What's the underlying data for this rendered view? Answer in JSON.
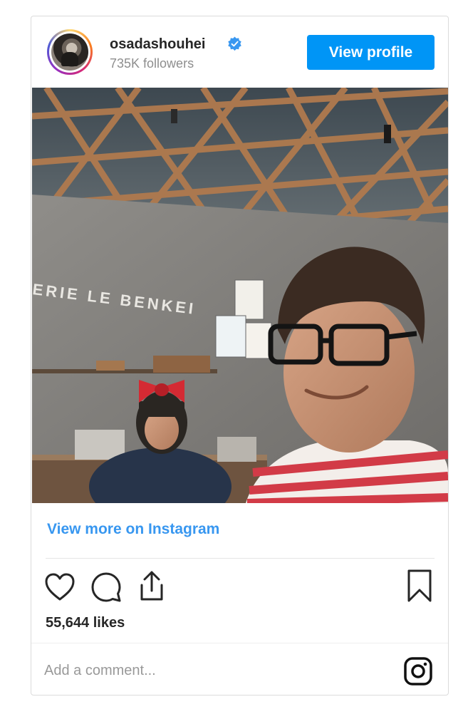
{
  "post": {
    "username": "osadashouhei",
    "followers": "735K followers",
    "view_profile_label": "View profile",
    "view_more_label": "View more on Instagram",
    "likes": "55,644 likes",
    "comment_placeholder": "Add a comment...",
    "photo_sign_text": "ERIE   LE BENKEI"
  },
  "icons": {
    "verified": "verified-badge-icon",
    "like": "heart-icon",
    "comment": "comment-bubble-icon",
    "share": "share-icon",
    "save": "bookmark-icon",
    "instagram": "instagram-logo-icon"
  },
  "colors": {
    "accent": "#0095f6",
    "link": "#3897f0",
    "muted": "#8e8e8e",
    "border": "#dbdbdb"
  }
}
